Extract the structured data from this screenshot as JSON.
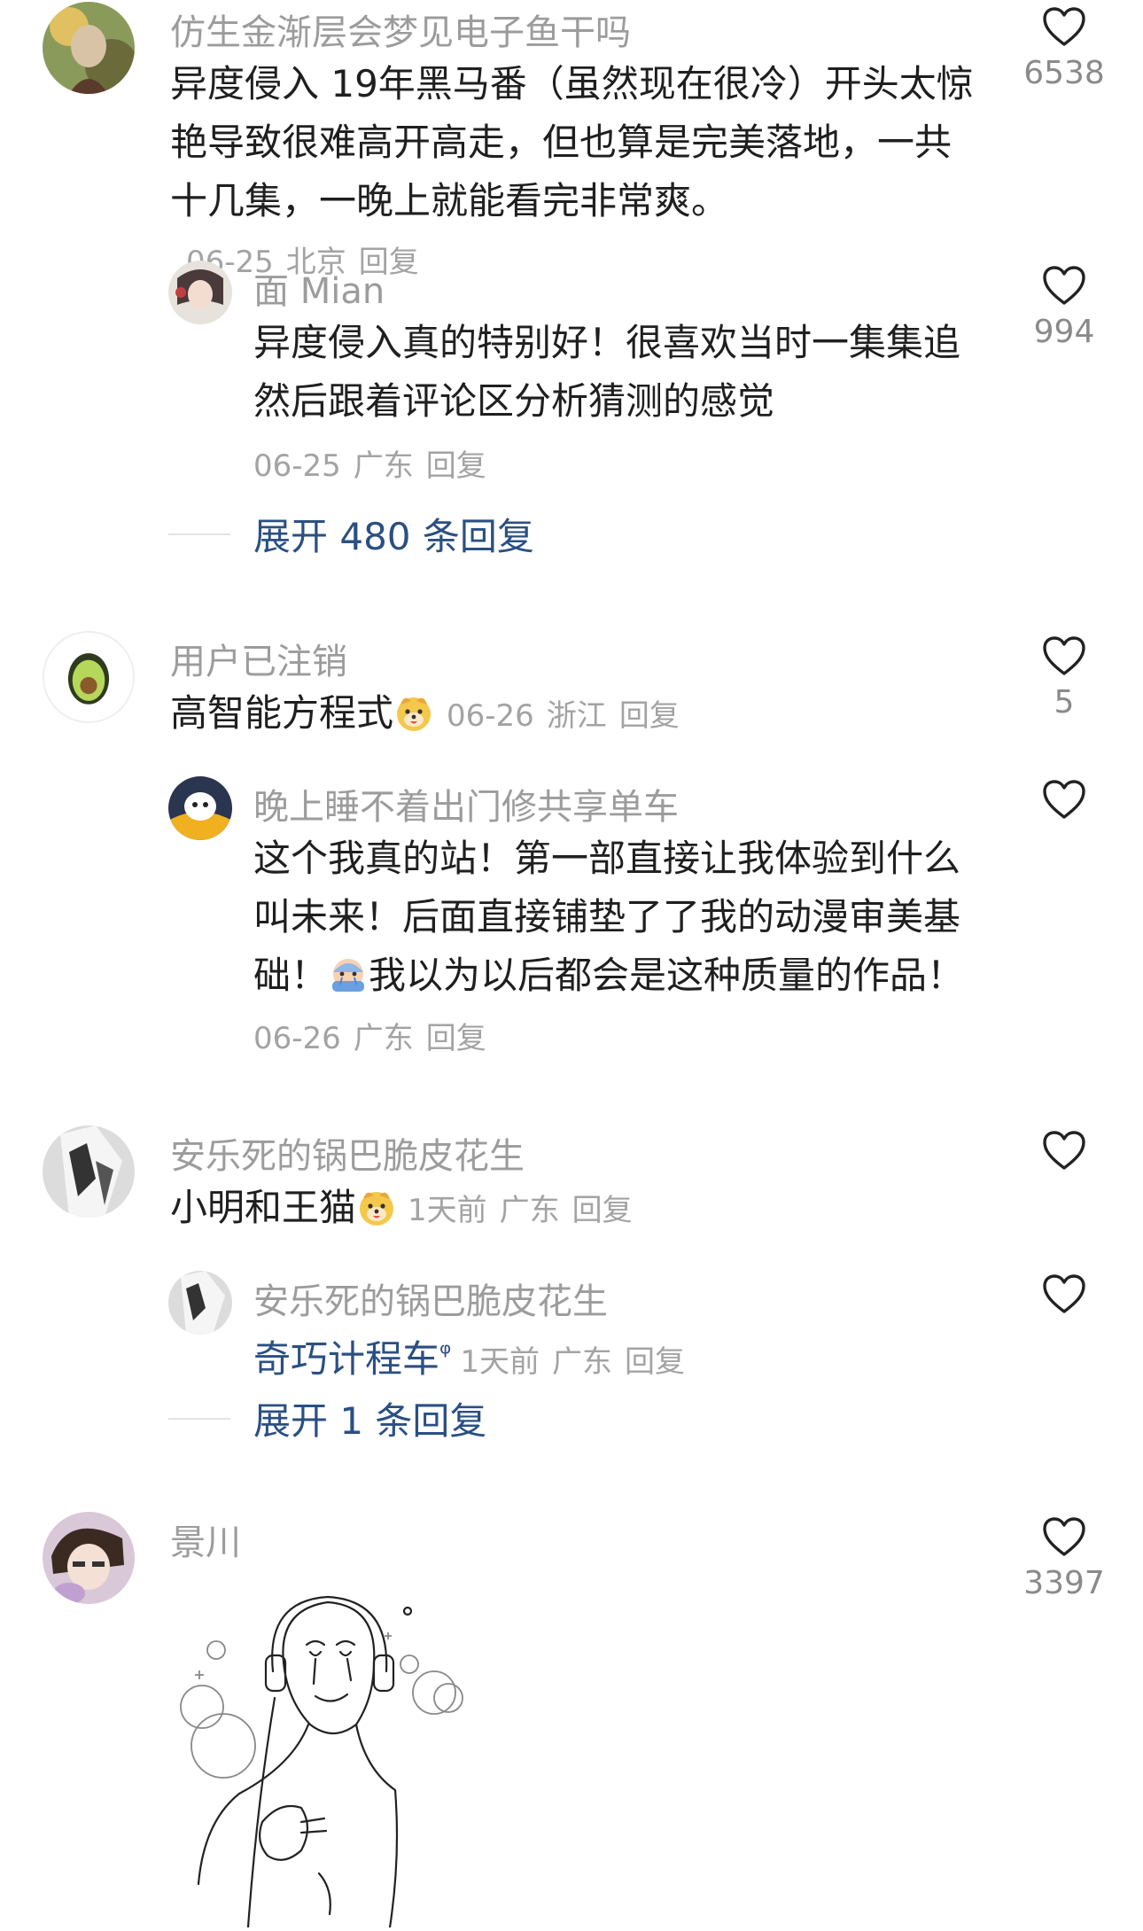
{
  "comments": [
    {
      "user": "仿生金渐层会梦见电子鱼干吗",
      "text": "异度侵入  19年黑马番（虽然现在很冷）开头太惊艳导致很难高开高走，但也算是完美落地，一共十几集，一晚上就能看完非常爽。",
      "date": "06-25",
      "location": "北京",
      "reply_label": "回复",
      "likes": "6538",
      "replies": [
        {
          "user": "面 Mian",
          "text": "异度侵入真的特别好！很喜欢当时一集集追然后跟着评论区分析猜测的感觉",
          "date": "06-25",
          "location": "广东",
          "reply_label": "回复",
          "likes": "994"
        }
      ],
      "expand_label": "展开 480 条回复"
    },
    {
      "user": "用户已注销",
      "text": "高智能方程式",
      "date": "06-26",
      "location": "浙江",
      "reply_label": "回复",
      "likes": "5",
      "replies": [
        {
          "user": "晚上睡不着出门修共享单车",
          "text_a": "这个我真的站！第一部直接让我体验到什么叫未来！后面直接铺垫了了我的动漫审美基础！",
          "text_b": "我以为以后都会是这种质量的作品！",
          "date": "06-26",
          "location": "广东",
          "reply_label": "回复"
        }
      ]
    },
    {
      "user": "安乐死的锅巴脆皮花生",
      "text": "小明和王猫",
      "date": "1天前",
      "location": "广东",
      "reply_label": "回复",
      "replies": [
        {
          "user": "安乐死的锅巴脆皮花生",
          "text": "奇巧计程车",
          "search_mark": "ᵠ",
          "date": "1天前",
          "location": "广东",
          "reply_label": "回复"
        }
      ],
      "expand_label": "展开 1 条回复"
    },
    {
      "user": "景川",
      "likes": "3397"
    }
  ],
  "colors": {
    "username": "#9c9c9c",
    "body_text": "#1f1f1f",
    "meta": "#a3a3a3",
    "link": "#2b4f83",
    "like_icon": "#222222"
  },
  "icons": [
    "heart-outline-icon",
    "smiling-dog-emoji",
    "crying-face-emoji"
  ]
}
